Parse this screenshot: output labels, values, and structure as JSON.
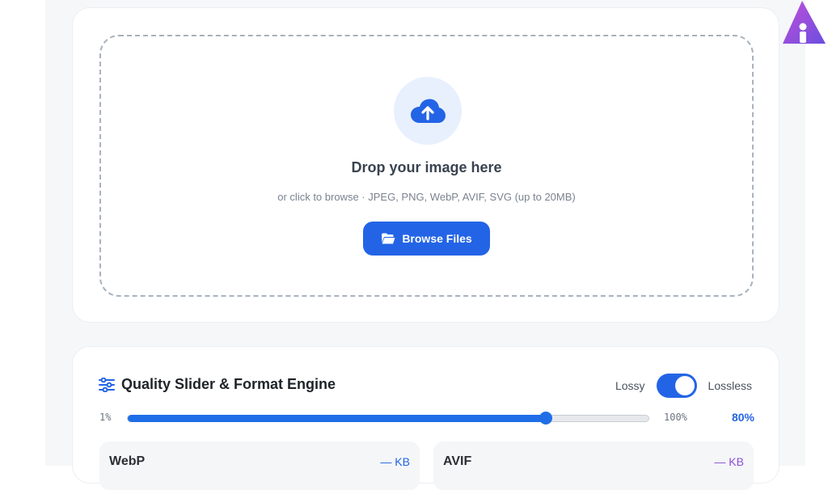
{
  "upload": {
    "title": "Drop your image here",
    "subtitle": "or click to browse · JPEG, PNG, WebP, AVIF, SVG (up to 20MB)",
    "browse_label": "Browse Files",
    "icon": "cloud-upload-icon"
  },
  "quality": {
    "title": "Quality Slider & Format Engine",
    "icon": "sliders-icon",
    "toggle_left": "Lossy",
    "toggle_right": "Lossless",
    "slider_min": "1%",
    "slider_max": "100%",
    "slider_value": "80%",
    "slider_level": 0.8,
    "formats": [
      {
        "name": "WebP",
        "size": "— KB"
      },
      {
        "name": "AVIF",
        "size": "— KB"
      }
    ]
  },
  "colors": {
    "accent": "#2364e6",
    "avif_accent": "#8a4fd6"
  },
  "logo": {
    "icon": "brand-logo-icon"
  }
}
